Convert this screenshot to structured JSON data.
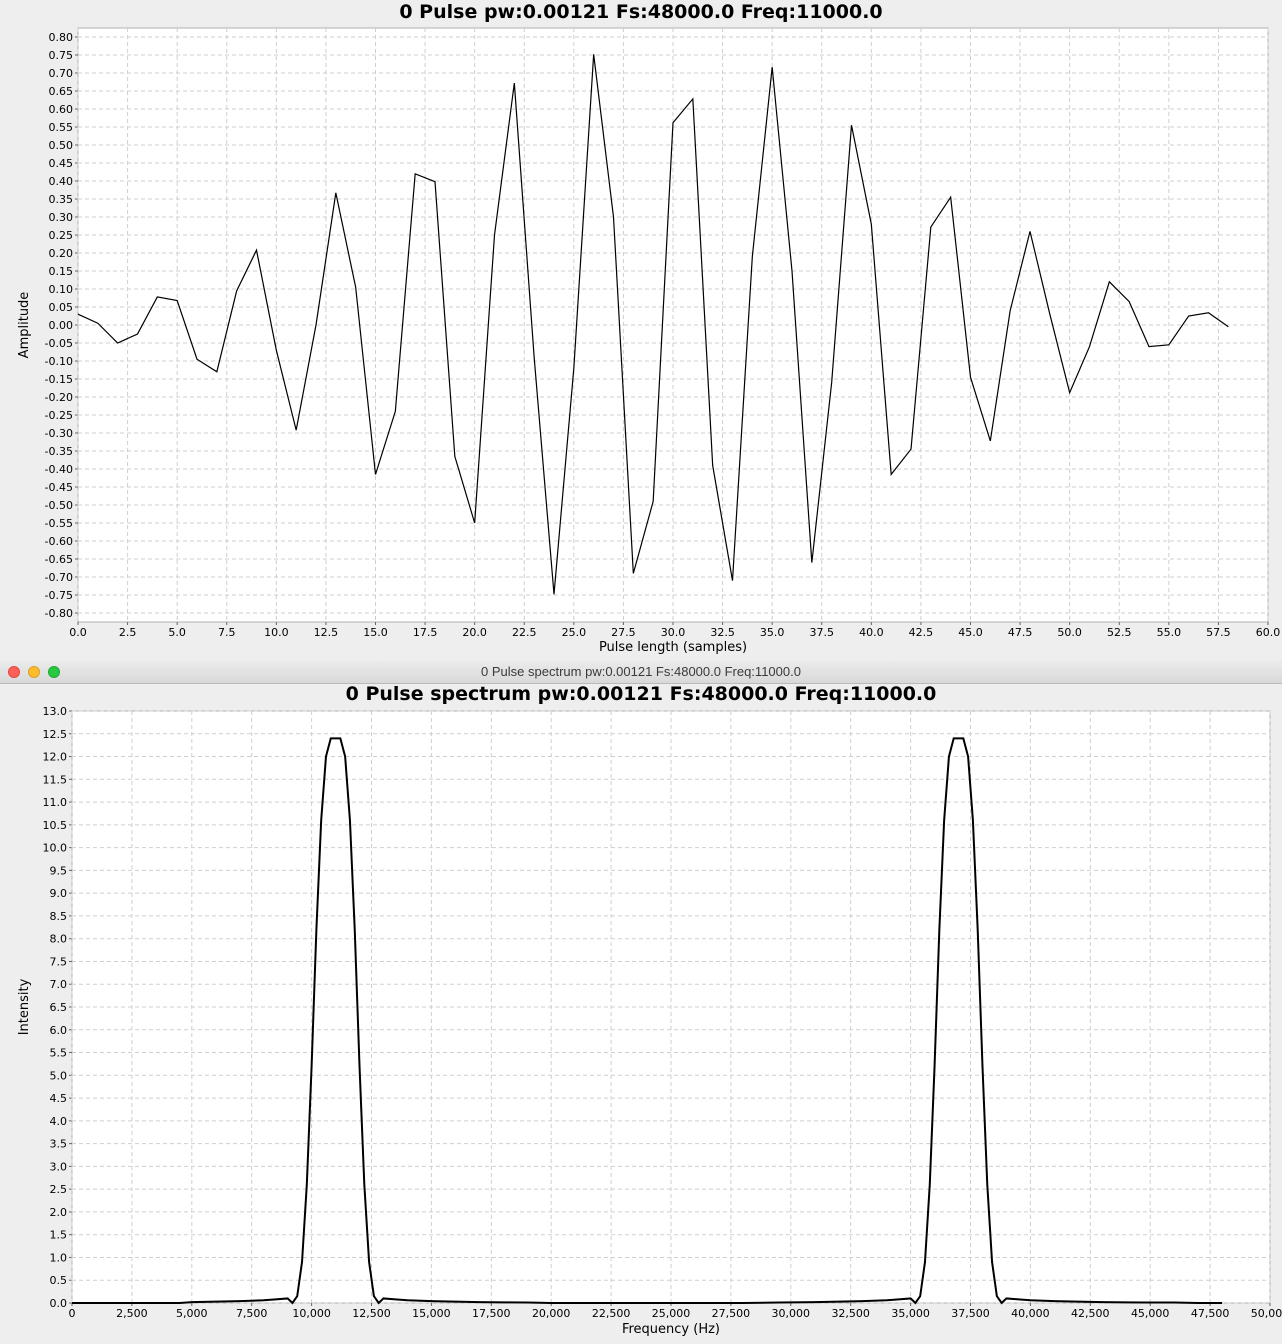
{
  "windows": {
    "bottom": {
      "window_title": "0 Pulse spectrum pw:0.00121 Fs:48000.0 Freq:11000.0"
    }
  },
  "chart_data": [
    {
      "type": "line",
      "title": "0 Pulse pw:0.00121 Fs:48000.0 Freq:11000.0",
      "xlabel": "Pulse length (samples)",
      "ylabel": "Amplitude",
      "xlim": [
        0,
        60
      ],
      "ylim": [
        -0.825,
        0.825
      ],
      "xticks": [
        "0.0",
        "2.5",
        "5.0",
        "7.5",
        "10.0",
        "12.5",
        "15.0",
        "17.5",
        "20.0",
        "22.5",
        "25.0",
        "27.5",
        "30.0",
        "32.5",
        "35.0",
        "37.5",
        "40.0",
        "42.5",
        "45.0",
        "47.5",
        "50.0",
        "52.5",
        "55.0",
        "57.5",
        "60.0"
      ],
      "yticks": [
        "0.80",
        "0.75",
        "0.70",
        "0.65",
        "0.60",
        "0.55",
        "0.50",
        "0.45",
        "0.40",
        "0.35",
        "0.30",
        "0.25",
        "0.20",
        "0.15",
        "0.10",
        "0.05",
        "0.00",
        "-0.05",
        "-0.10",
        "-0.15",
        "-0.20",
        "-0.25",
        "-0.30",
        "-0.35",
        "-0.40",
        "-0.45",
        "-0.50",
        "-0.55",
        "-0.60",
        "-0.65",
        "-0.70",
        "-0.75",
        "-0.80"
      ],
      "grid": true,
      "series": [
        {
          "color": "#000000",
          "x": [
            0,
            1,
            2,
            3,
            4,
            5,
            6,
            7,
            8,
            9,
            10,
            11,
            12,
            13,
            14,
            15,
            16,
            17,
            18,
            19,
            20,
            21,
            22,
            23,
            24,
            25,
            26,
            27,
            28,
            29,
            30,
            31,
            32,
            33,
            34,
            35,
            36,
            37,
            38,
            39,
            40,
            41,
            42,
            43,
            44,
            45,
            46,
            47,
            48,
            49,
            50,
            51,
            52,
            53,
            54,
            55,
            56,
            57,
            58
          ],
          "y": [
            0.03,
            0.005,
            -0.05,
            -0.025,
            0.078,
            0.068,
            -0.095,
            -0.13,
            0.095,
            0.208,
            -0.07,
            -0.292,
            0.0,
            0.367,
            0.105,
            -0.415,
            -0.24,
            0.42,
            0.398,
            -0.365,
            -0.55,
            0.25,
            0.672,
            -0.09,
            -0.748,
            -0.12,
            0.752,
            0.3,
            -0.69,
            -0.49,
            0.562,
            0.628,
            -0.39,
            -0.71,
            0.19,
            0.716,
            0.15,
            -0.66,
            -0.16,
            0.555,
            0.28,
            -0.415,
            -0.345,
            0.272,
            0.355,
            -0.145,
            -0.322,
            0.04,
            0.26,
            0.03,
            -0.188,
            -0.06,
            0.12,
            0.065,
            -0.06,
            -0.055,
            0.025,
            0.034,
            -0.005
          ]
        }
      ]
    },
    {
      "type": "line",
      "title": "0 Pulse spectrum pw:0.00121 Fs:48000.0 Freq:11000.0",
      "xlabel": "Frequency (Hz)",
      "ylabel": "Intensity",
      "xlim": [
        0,
        50000
      ],
      "ylim": [
        0,
        13
      ],
      "xticks": [
        "0",
        "2,500",
        "5,000",
        "7,500",
        "10,000",
        "12,500",
        "15,000",
        "17,500",
        "20,000",
        "22,500",
        "25,000",
        "27,500",
        "30,000",
        "32,500",
        "35,000",
        "37,500",
        "40,000",
        "42,500",
        "45,000",
        "47,500",
        "50,000"
      ],
      "yticks": [
        "13.0",
        "12.5",
        "12.0",
        "11.5",
        "11.0",
        "10.5",
        "10.0",
        "9.5",
        "9.0",
        "8.5",
        "8.0",
        "7.5",
        "7.0",
        "6.5",
        "6.0",
        "5.5",
        "5.0",
        "4.5",
        "4.0",
        "3.5",
        "3.0",
        "2.5",
        "2.0",
        "1.5",
        "1.0",
        "0.5",
        "0.0"
      ],
      "grid": true,
      "series": [
        {
          "color": "#000000",
          "x": [
            0,
            4500,
            5000,
            6000,
            7000,
            8000,
            8500,
            9000,
            9200,
            9400,
            9600,
            9800,
            10000,
            10200,
            10400,
            10600,
            10800,
            11000,
            11200,
            11400,
            11600,
            11800,
            12000,
            12200,
            12400,
            12600,
            12800,
            13000,
            13500,
            14000,
            15000,
            16000,
            17000,
            18000,
            19000,
            20000,
            22000,
            24000,
            26000,
            28000,
            29500,
            30000,
            31000,
            32000,
            33000,
            34000,
            34500,
            35000,
            35200,
            35400,
            35600,
            35800,
            36000,
            36200,
            36400,
            36600,
            36800,
            37000,
            37200,
            37400,
            37600,
            37800,
            38000,
            38200,
            38400,
            38600,
            38800,
            39000,
            39500,
            40000,
            41000,
            42000,
            43000,
            44000,
            45000,
            46000,
            47000,
            48000
          ],
          "y": [
            0,
            0,
            0.02,
            0.03,
            0.04,
            0.06,
            0.08,
            0.1,
            0.0,
            0.15,
            0.9,
            2.6,
            5.2,
            8.2,
            10.6,
            12.0,
            12.4,
            12.4,
            12.4,
            12.0,
            10.6,
            8.2,
            5.2,
            2.6,
            0.9,
            0.15,
            0.0,
            0.1,
            0.08,
            0.06,
            0.04,
            0.03,
            0.02,
            0.015,
            0.01,
            0.0,
            0.0,
            0.0,
            0.0,
            0.0,
            0.01,
            0.015,
            0.02,
            0.03,
            0.04,
            0.06,
            0.08,
            0.1,
            0.0,
            0.15,
            0.9,
            2.6,
            5.2,
            8.2,
            10.6,
            12.0,
            12.4,
            12.4,
            12.4,
            12.0,
            10.6,
            8.2,
            5.2,
            2.6,
            0.9,
            0.15,
            0.0,
            0.1,
            0.08,
            0.06,
            0.04,
            0.03,
            0.02,
            0.015,
            0.01,
            0.01,
            0.0,
            0.0
          ]
        }
      ]
    }
  ]
}
